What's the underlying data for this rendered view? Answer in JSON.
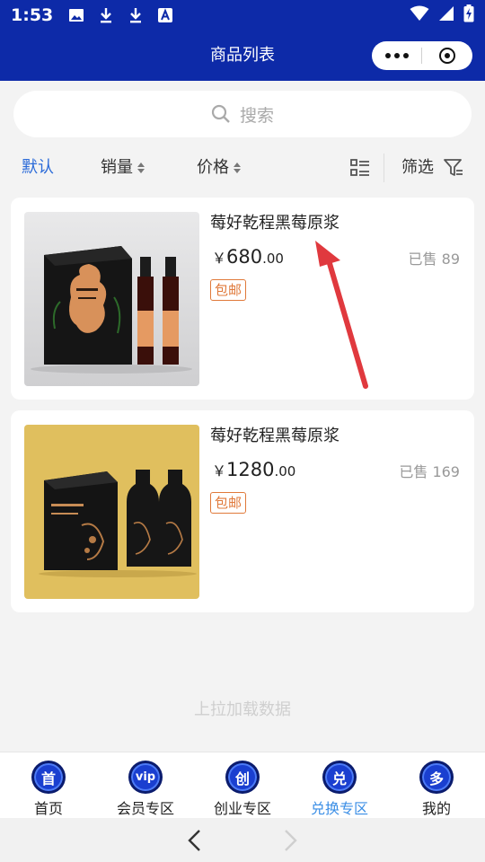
{
  "status_bar": {
    "time": "1:53",
    "icons_left": [
      "image-icon",
      "download-icon",
      "download-icon",
      "text-a-icon"
    ],
    "icons_right": [
      "wifi-icon",
      "signal-icon",
      "battery-charging-icon"
    ]
  },
  "nav": {
    "title": "商品列表",
    "accent": "#0d2aa8"
  },
  "search": {
    "placeholder": "搜索"
  },
  "sort": {
    "default_label": "默认",
    "sales_label": "销量",
    "price_label": "价格",
    "filter_label": "筛选"
  },
  "products": [
    {
      "title": "莓好乾程黑莓原浆",
      "currency": "￥",
      "price_int": "680",
      "price_dec": ".00",
      "sold": "已售 89",
      "tag": "包邮"
    },
    {
      "title": "莓好乾程黑莓原浆",
      "currency": "￥",
      "price_int": "1280",
      "price_dec": ".00",
      "sold": "已售 169",
      "tag": "包邮"
    }
  ],
  "load_more": "上拉加载数据",
  "tabs": [
    {
      "icon_text": "首",
      "label": "首页"
    },
    {
      "icon_text": "vip",
      "label": "会员专区"
    },
    {
      "icon_text": "创",
      "label": "创业专区"
    },
    {
      "icon_text": "兑",
      "label": "兑换专区"
    },
    {
      "icon_text": "多",
      "label": "我的"
    }
  ],
  "active_tab": "兑换专区",
  "colors": {
    "active_sort": "#2a6ad8",
    "active_tab": "#3a8ee6",
    "tag": "#e0793a",
    "annotation_arrow": "#e0393e"
  }
}
